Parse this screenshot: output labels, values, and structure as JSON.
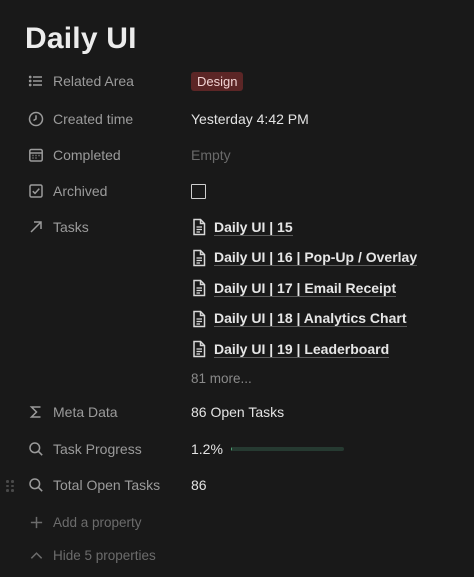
{
  "page": {
    "title": "Daily UI"
  },
  "properties": {
    "related_area": {
      "key": "Related Area",
      "value": "Design",
      "icon": "list-icon",
      "tag_color": "#5c2626"
    },
    "created_time": {
      "key": "Created time",
      "value": "Yesterday 4:42 PM",
      "icon": "clock-icon"
    },
    "completed": {
      "key": "Completed",
      "value": "Empty",
      "icon": "calendar-icon"
    },
    "archived": {
      "key": "Archived",
      "checked": false,
      "icon": "checkbox-icon"
    },
    "tasks": {
      "key": "Tasks",
      "icon": "arrow-up-right-icon",
      "items": [
        {
          "label": "Daily UI | 15",
          "icon": "document-icon"
        },
        {
          "label": "Daily UI | 16 | Pop-Up / Overlay",
          "icon": "document-icon"
        },
        {
          "label": "Daily UI | 17 | Email Receipt",
          "icon": "document-icon"
        },
        {
          "label": "Daily UI | 18 | Analytics Chart",
          "icon": "document-icon"
        },
        {
          "label": "Daily UI | 19 | Leaderboard",
          "icon": "document-icon"
        }
      ],
      "more_label": "81 more..."
    },
    "meta_data": {
      "key": "Meta Data",
      "value": "86 Open Tasks",
      "icon": "sigma-icon"
    },
    "task_progress": {
      "key": "Task Progress",
      "value": "1.2%",
      "progress": 0.012,
      "icon": "search-icon",
      "bar_color": "#4ea173"
    },
    "total_open_tasks": {
      "key": "Total Open Tasks",
      "value": "86",
      "icon": "search-icon"
    }
  },
  "footer": {
    "add_property": "Add a property",
    "hide_properties": "Hide 5 properties"
  }
}
